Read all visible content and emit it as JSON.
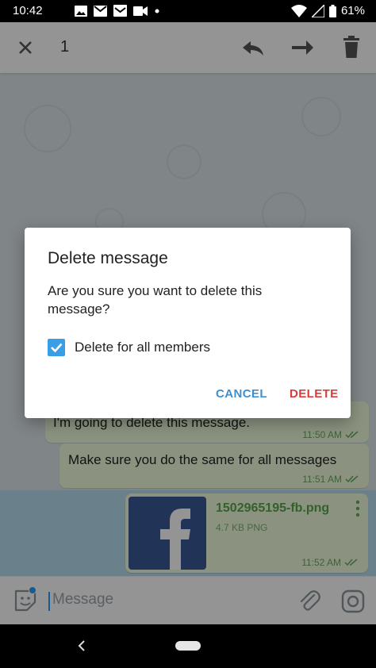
{
  "status_bar": {
    "time": "10:42",
    "battery": "61%",
    "icons": [
      "image-icon",
      "gmail-icon",
      "inbox-icon",
      "video-icon",
      "dot-icon",
      "wifi-icon",
      "signal-icon",
      "battery-icon"
    ]
  },
  "toolbar": {
    "selected_count": "1",
    "icons": [
      "close-icon",
      "reply-icon",
      "forward-icon",
      "trash-icon"
    ]
  },
  "messages": [
    {
      "text": "I'm going to delete this message.",
      "time": "11:50 AM"
    },
    {
      "text": "Make sure you do the same for all messages",
      "time": "11:51 AM"
    }
  ],
  "file_message": {
    "filename": "1502965195-fb.png",
    "info": "4.7 KB PNG",
    "time": "11:52 AM"
  },
  "composer": {
    "placeholder": "Message"
  },
  "dialog": {
    "title": "Delete message",
    "body": "Are you sure you want to delete this message?",
    "checkbox_label": "Delete for all members",
    "checkbox_checked": true,
    "cancel_label": "CANCEL",
    "delete_label": "DELETE"
  },
  "colors": {
    "accent": "#3a9ee4",
    "danger": "#db3b3b",
    "bubble": "#effedd",
    "selected_row": "#b7dcf0"
  }
}
